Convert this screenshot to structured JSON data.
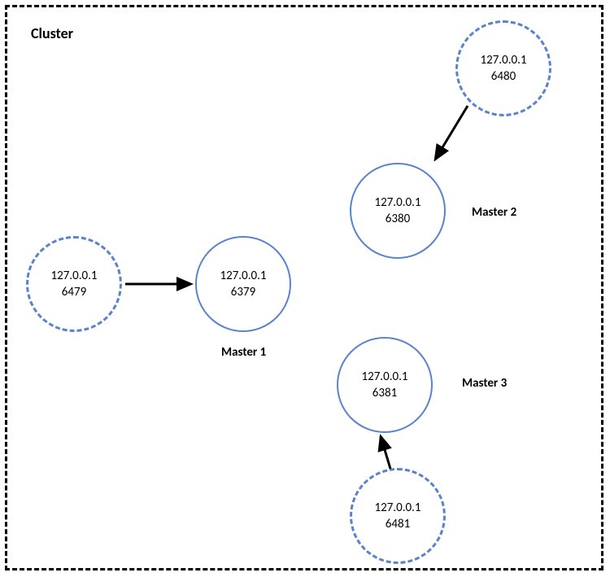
{
  "title": "Cluster",
  "ip": "127.0.0.1",
  "masters": {
    "m1": {
      "label": "Master 1",
      "port": "6379",
      "slave_port": "6479"
    },
    "m2": {
      "label": "Master 2",
      "port": "6380",
      "slave_port": "6480"
    },
    "m3": {
      "label": "Master 3",
      "port": "6381",
      "slave_port": "6481"
    }
  },
  "colors": {
    "node_border": "#5b83c9",
    "text": "#000000"
  }
}
